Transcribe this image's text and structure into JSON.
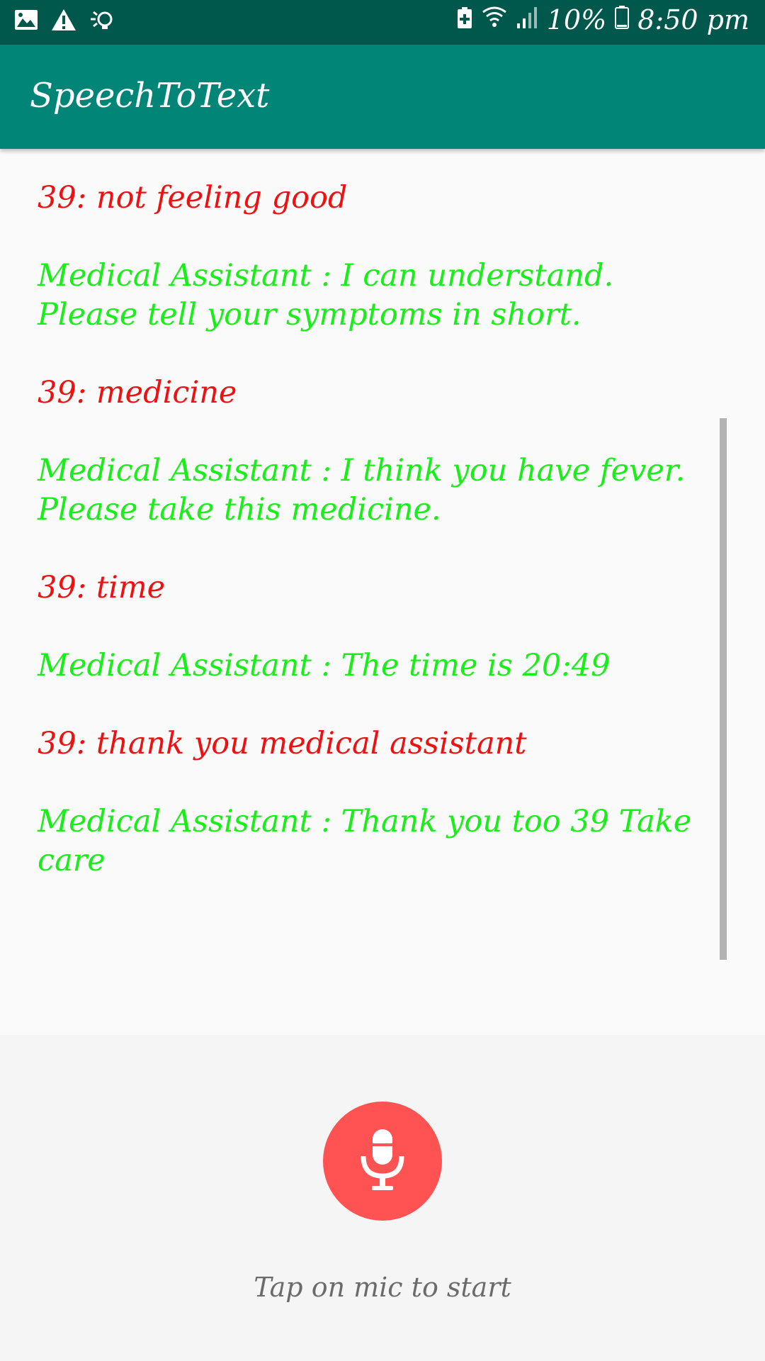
{
  "status_bar": {
    "left_icons": [
      "image-icon",
      "warning-icon",
      "lightbulb-icon"
    ],
    "right_icons": [
      "battery-saver-icon",
      "wifi-icon",
      "signal-icon",
      "battery-icon"
    ],
    "battery": "10%",
    "time": "8:50 pm"
  },
  "app_bar": {
    "title": "SpeechToText"
  },
  "conversation": [
    {
      "speaker": "user",
      "text": "39: not feeling good"
    },
    {
      "speaker": "assistant",
      "text": "Medical Assistant : I can understand. Please tell your symptoms in short."
    },
    {
      "speaker": "user",
      "text": "39: medicine"
    },
    {
      "speaker": "assistant",
      "text": "Medical Assistant : I think you have fever. Please take this medicine."
    },
    {
      "speaker": "user",
      "text": "39: time"
    },
    {
      "speaker": "assistant",
      "text": "Medical Assistant : The time is 20:49"
    },
    {
      "speaker": "user",
      "text": "39: thank you medical assistant"
    },
    {
      "speaker": "assistant",
      "text": "Medical Assistant : Thank you too 39 Take care"
    }
  ],
  "mic": {
    "icon": "microphone-icon",
    "hint": "Tap on mic to start"
  },
  "colors": {
    "status_bar": "#00574b",
    "app_bar": "#008577",
    "user_text": "#ee1111",
    "assistant_text": "#18ee18",
    "mic_button": "#ff5252"
  }
}
